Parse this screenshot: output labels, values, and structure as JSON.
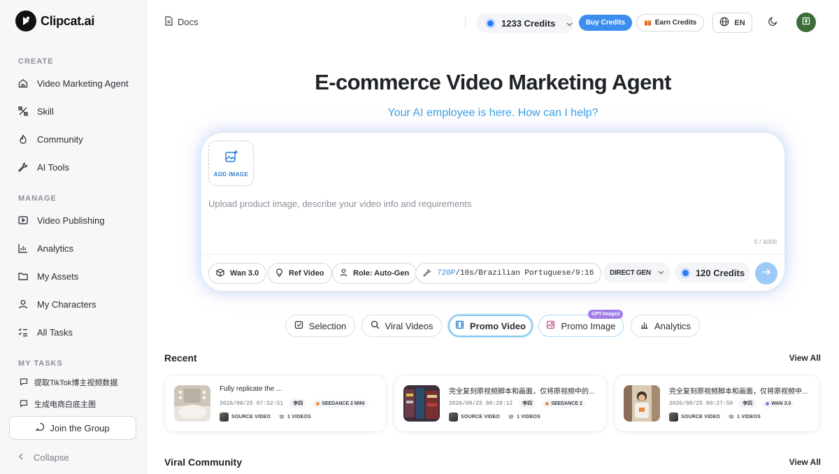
{
  "brand": {
    "name": "Clipcat.ai"
  },
  "sidebar": {
    "create_label": "CREATE",
    "create_items": [
      {
        "label": "Video Marketing Agent",
        "icon": "home-icon"
      },
      {
        "label": "Skill",
        "icon": "skill-icon"
      },
      {
        "label": "Community",
        "icon": "flame-icon"
      },
      {
        "label": "AI Tools",
        "icon": "wrench-icon"
      }
    ],
    "manage_label": "MANAGE",
    "manage_items": [
      {
        "label": "Video Publishing",
        "icon": "publish-icon"
      },
      {
        "label": "Analytics",
        "icon": "bar-chart-icon"
      },
      {
        "label": "My Assets",
        "icon": "folder-icon"
      },
      {
        "label": "My Characters",
        "icon": "user-icon"
      },
      {
        "label": "All Tasks",
        "icon": "task-list-icon"
      }
    ],
    "tasks_label": "MY TASKS",
    "tasks": [
      {
        "label": "提取TikTok博主视频数据"
      },
      {
        "label": "生成电商白底主图"
      }
    ],
    "join_label": "Join the Group",
    "collapse_label": "Collapse"
  },
  "header": {
    "docs_label": "Docs",
    "credits": "1233 Credits",
    "buy_label": "Buy Credits",
    "earn_label": "Earn Credits",
    "lang": "EN"
  },
  "hero": {
    "title": "E-commerce Video Marketing Agent",
    "subtitle": "Your AI employee is here. How can I help?"
  },
  "composer": {
    "add_image_label": "ADD IMAGE",
    "placeholder": "Upload product image, describe your video info and requirements",
    "char_count": "0 / 4000",
    "model_label": "Wan 3.0",
    "ref_label": "Ref Video",
    "role_label": "Role: Auto-Gen",
    "spec_highlight": "720P",
    "spec_rest": "/10s/Brazilian Portuguese/9:16",
    "mode_label": "DIRECT GEN",
    "cost_label": "120 Credits"
  },
  "tabs": [
    {
      "label": "Selection",
      "icon": "selection-icon"
    },
    {
      "label": "Viral Videos",
      "icon": "search-icon"
    },
    {
      "label": "Promo Video",
      "icon": "film-icon"
    },
    {
      "label": "Promo Image",
      "icon": "image-icon",
      "badge": "GPT-Image2"
    },
    {
      "label": "Analytics",
      "icon": "bar-chart-icon"
    }
  ],
  "recent": {
    "title": "Recent",
    "view_all": "View All",
    "cards": [
      {
        "title": "Fully replicate the ...",
        "timestamp": "2026/08/25 07:52:51",
        "user": "李四",
        "model": "SEEDANCE 2 MINI",
        "model_color": "#f08a3c",
        "source": "SOURCE VIDEO",
        "videos": "1 VIDEOS"
      },
      {
        "title": "完全复刻原视频脚本和画面，仅将原视频中的...",
        "timestamp": "2026/08/25 00:28:12",
        "user": "李四",
        "model": "SEEDANCE 2",
        "model_color": "#f08a3c",
        "source": "SOURCE VIDEO",
        "videos": "1 VIDEOS"
      },
      {
        "title": "完全复刻原视频脚本和画面，仅将原视频中...",
        "timestamp": "2026/08/25 00:27:50",
        "user": "李四",
        "model": "WAN 3.0",
        "model_color": "#9b6be8",
        "source": "SOURCE VIDEO",
        "videos": "1 VIDEOS"
      }
    ]
  },
  "viral": {
    "title": "Viral Community",
    "view_all": "View All"
  }
}
